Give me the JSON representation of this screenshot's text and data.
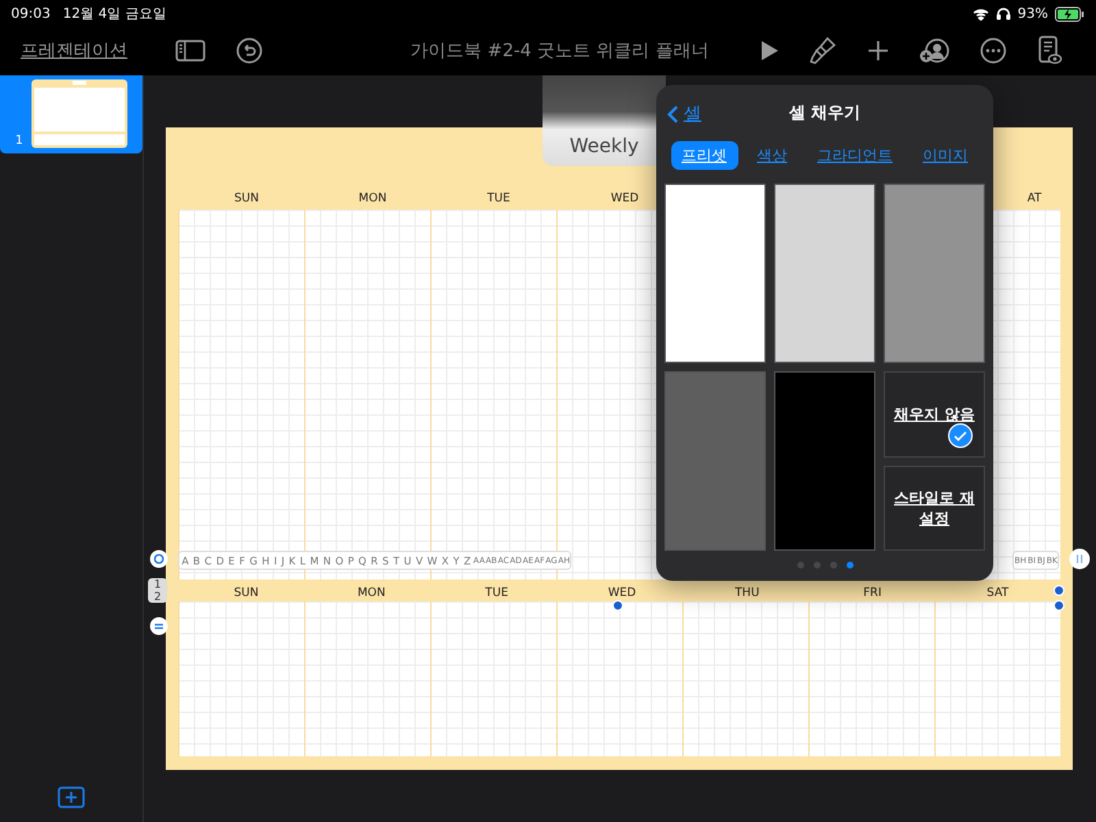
{
  "status_bar": {
    "time": "09:03",
    "date": "12월 4일 금요일",
    "battery": "93%"
  },
  "toolbar": {
    "back_label": "프레젠테이션",
    "title": "가이드북 #2-4 굿노트 위클리 플래너"
  },
  "sidebar": {
    "slides": [
      {
        "number": "1",
        "selected": true
      }
    ]
  },
  "slide": {
    "title": "Weekly",
    "weeks": [
      {
        "days": [
          "SUN",
          "MON",
          "TUE",
          "WED"
        ],
        "last_day": "AT"
      },
      {
        "days": [
          "SUN",
          "MON",
          "TUE",
          "WED",
          "THU",
          "FRI",
          "SAT"
        ]
      }
    ],
    "column_letters_left": [
      "A",
      "B",
      "C",
      "D",
      "E",
      "F",
      "G",
      "H",
      "I",
      "J",
      "K",
      "L",
      "M",
      "N",
      "O",
      "P",
      "Q",
      "R",
      "S",
      "T",
      "U",
      "V",
      "W",
      "X",
      "Y",
      "Z",
      "AA",
      "AB",
      "AC",
      "AD",
      "AE",
      "AF",
      "AG",
      "AH"
    ],
    "column_letters_right": [
      "BH",
      "BI",
      "BJ",
      "BK"
    ],
    "row_numbers": [
      "1",
      "2"
    ]
  },
  "popover": {
    "back": "셀",
    "title": "셀 채우기",
    "tabs": [
      {
        "label": "프리셋",
        "selected": true
      },
      {
        "label": "색상",
        "selected": false
      },
      {
        "label": "그라디언트",
        "selected": false
      },
      {
        "label": "이미지",
        "selected": false
      }
    ],
    "swatches": [
      {
        "color": "#ffffff"
      },
      {
        "color": "#d6d6d6"
      },
      {
        "color": "#929292"
      },
      {
        "color": "#5e5e5e"
      },
      {
        "color": "#000000"
      }
    ],
    "options": [
      {
        "label": "채우지 않음",
        "checked": true
      },
      {
        "label": "스타일로 재설정",
        "checked": false
      }
    ],
    "pages": [
      {
        "selected": false
      },
      {
        "selected": false
      },
      {
        "selected": false
      },
      {
        "selected": true
      }
    ]
  }
}
